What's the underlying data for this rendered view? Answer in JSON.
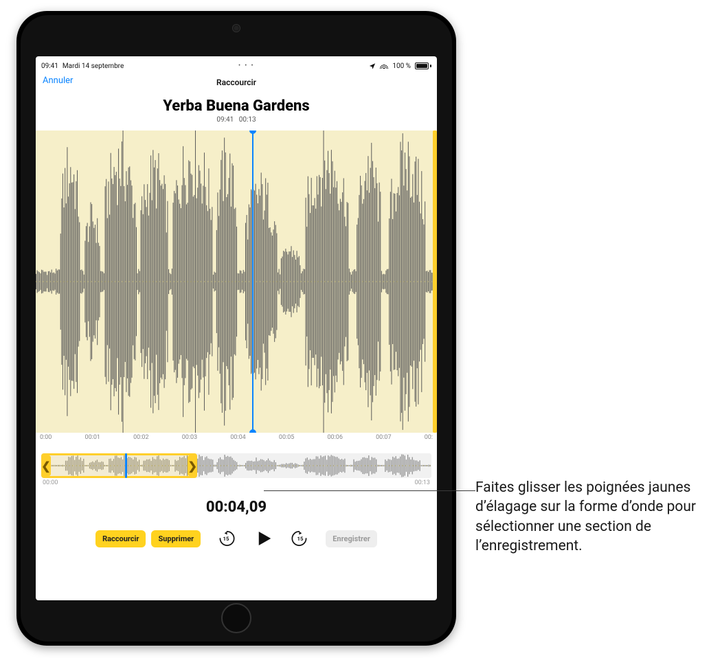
{
  "status": {
    "time": "09:41",
    "date": "Mardi 14 septembre",
    "battery_pct": "100 %",
    "location_icon": "location-arrow-icon",
    "wifi_icon": "wifi-icon",
    "battery_icon": "battery-icon"
  },
  "nav": {
    "cancel": "Annuler",
    "title": "Raccourcir"
  },
  "recording": {
    "title": "Yerba Buena Gardens",
    "created_time": "09:41",
    "duration": "00:13"
  },
  "ruler": {
    "ticks": [
      "0:00",
      "00:01",
      "00:02",
      "00:03",
      "00:04",
      "00:05",
      "00:06",
      "00:07",
      "00:"
    ]
  },
  "overview_ruler": {
    "start": "00:00",
    "end": "00:13"
  },
  "timer": "00:04,09",
  "controls": {
    "trim": "Raccourcir",
    "delete": "Supprimer",
    "skip_back": "15",
    "skip_fwd": "15",
    "save": "Enregistrer"
  },
  "callout": {
    "text": "Faites glisser les poignées jaunes d’élagage sur la forme d’onde pour sélectionner une section de l’enregistrement."
  },
  "colors": {
    "accent": "#0a84ff",
    "trim": "#ffcf2b",
    "wave_bg": "#f6efc9",
    "wave_fg": "#5b5b5b"
  },
  "playhead_fraction": 0.54,
  "overview": {
    "sel_start_fraction": 0.0,
    "sel_end_fraction": 0.4,
    "playhead_fraction": 0.215
  }
}
